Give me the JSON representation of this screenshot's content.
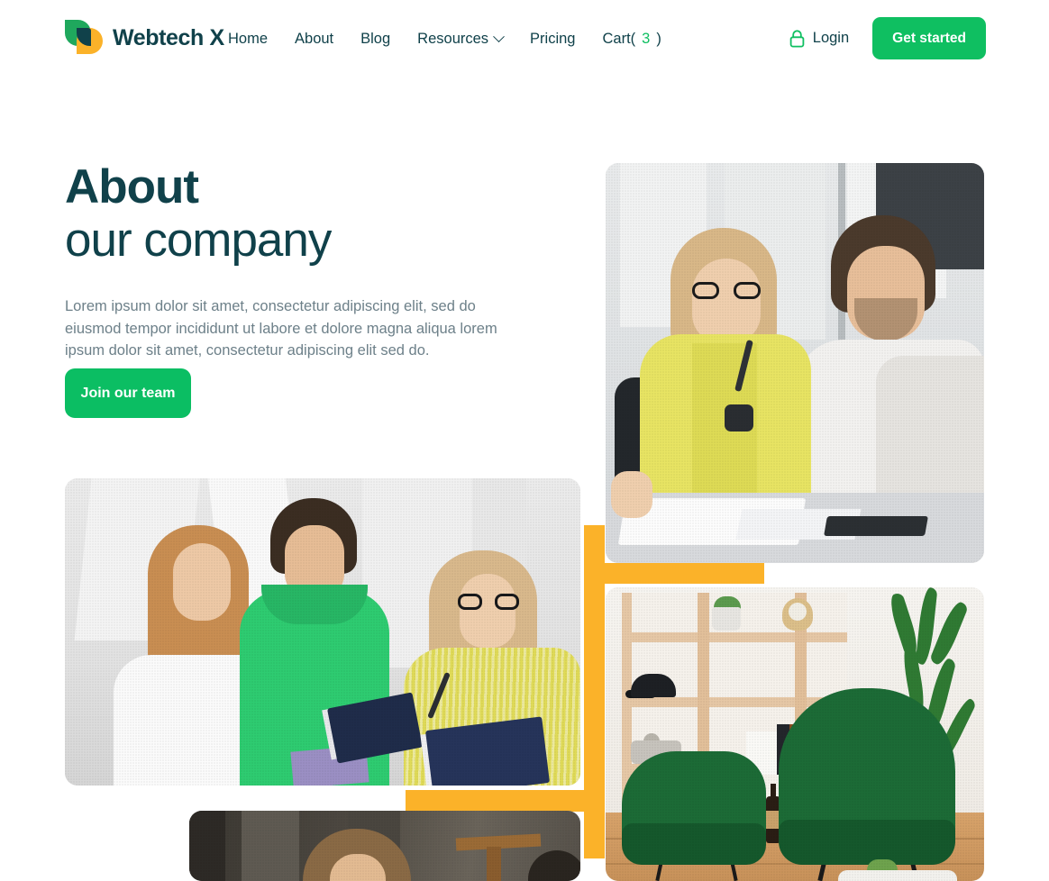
{
  "brand": {
    "name": "Webtech X",
    "logo_icon": "leaf-logo-icon",
    "green": "#1FA85D",
    "yellow": "#FBB229",
    "dark": "#10414A"
  },
  "nav": {
    "items": [
      {
        "label": "Home",
        "has_dropdown": false
      },
      {
        "label": "About",
        "has_dropdown": false
      },
      {
        "label": "Blog",
        "has_dropdown": false
      },
      {
        "label": "Resources",
        "has_dropdown": true
      },
      {
        "label": "Pricing",
        "has_dropdown": false
      }
    ],
    "cart": {
      "label_prefix": "Cart(",
      "count": "3",
      "label_suffix": ")"
    }
  },
  "header_actions": {
    "login": {
      "label": "Login",
      "icon": "lock-icon"
    },
    "get_started": {
      "label": "Get started"
    }
  },
  "hero": {
    "title_bold": "About",
    "title_light": "our company",
    "paragraph": "Lorem ipsum dolor sit amet, consectetur adipiscing elit, sed do eiusmod tempor incididunt ut labore et dolore magna aliqua lorem ipsum dolor sit amet, consectetur adipiscing elit sed do.",
    "cta": {
      "label": "Join our team"
    }
  },
  "gallery": {
    "accent_color": "#FBB229",
    "photos": [
      {
        "name": "colleagues-at-desk",
        "alt": "Two colleagues smiling at a desk by a window"
      },
      {
        "name": "team-discussion",
        "alt": "Three team members standing and reviewing notebooks"
      },
      {
        "name": "lounge-interior",
        "alt": "Office lounge with green armchairs and shelving"
      },
      {
        "name": "portrait-dark",
        "alt": "Person in a dimly lit room"
      }
    ]
  },
  "colors": {
    "accent_green": "#0FBF61",
    "accent_yellow": "#FBB229",
    "text_dark": "#10414A",
    "text_muted": "#6D8089",
    "background": "#FFFFFF"
  }
}
